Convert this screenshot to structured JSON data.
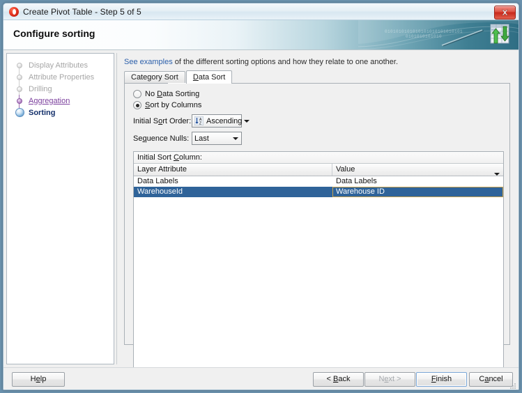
{
  "window": {
    "title": "Create Pivot Table - Step 5 of 5",
    "close_label": "✖",
    "app_icon": "oracle-circle-icon"
  },
  "banner": {
    "heading": "Configure sorting",
    "bits_line1": "0101010101010101010101010101",
    "bits_line2": "0101010101010",
    "logo_icon": "pivot-table-sort-icon"
  },
  "sidebar": {
    "steps": [
      {
        "label": "Display Attributes",
        "state": "disabled"
      },
      {
        "label": "Attribute Properties",
        "state": "disabled"
      },
      {
        "label": "Drilling",
        "state": "disabled"
      },
      {
        "label": "Aggregation",
        "state": "visited"
      },
      {
        "label": "Sorting",
        "state": "current"
      }
    ]
  },
  "main": {
    "hint_link": "See examples",
    "hint_rest": " of the different sorting options and how they relate to one another.",
    "tabs": [
      {
        "label": "Category Sort",
        "active": false
      },
      {
        "label": "Data Sort",
        "active": true
      }
    ],
    "radios": [
      {
        "label_pre": "No ",
        "label_key": "D",
        "label_post": "ata Sorting",
        "checked": false
      },
      {
        "label_pre": "",
        "label_key": "S",
        "label_post": "ort by Columns",
        "checked": true
      }
    ],
    "fields": [
      {
        "label_pre": "Initial S",
        "label_key": "o",
        "label_post": "rt Order:",
        "value": "Ascending",
        "icon": "sort-ascending-az-icon"
      },
      {
        "label_pre": "Se",
        "label_key": "q",
        "label_post": "uence Nulls:",
        "value": "Last",
        "icon": ""
      }
    ],
    "sort_column": {
      "title_pre": "Initial Sort ",
      "title_key": "C",
      "title_post": "olumn:",
      "columns": [
        "Layer Attribute",
        "Value"
      ],
      "rows": [
        {
          "cells": [
            "Data Labels",
            "Data Labels"
          ],
          "selected": false
        },
        {
          "cells": [
            "WarehouseId",
            "Warehouse ID"
          ],
          "selected": true
        }
      ]
    }
  },
  "footer": {
    "buttons": [
      {
        "key": "help",
        "pre": "H",
        "accel": "e",
        "post": "lp",
        "enabled": true,
        "focused": false
      },
      {
        "key": "back",
        "pre": "< ",
        "accel": "B",
        "post": "ack",
        "enabled": true,
        "focused": false
      },
      {
        "key": "next",
        "pre": "N",
        "accel": "e",
        "post": "xt >",
        "enabled": false,
        "focused": false
      },
      {
        "key": "finish",
        "pre": "",
        "accel": "F",
        "post": "inish",
        "enabled": true,
        "focused": true
      },
      {
        "key": "cancel",
        "pre": "C",
        "accel": "a",
        "post": "ncel",
        "enabled": true,
        "focused": false
      }
    ]
  },
  "colors": {
    "selection": "#2f6399",
    "link": "#2b5faa",
    "visited_step": "#7b3f9d",
    "current_step": "#14306b",
    "close_button": "#c9291c",
    "banner_teal": "#2f6e84"
  }
}
